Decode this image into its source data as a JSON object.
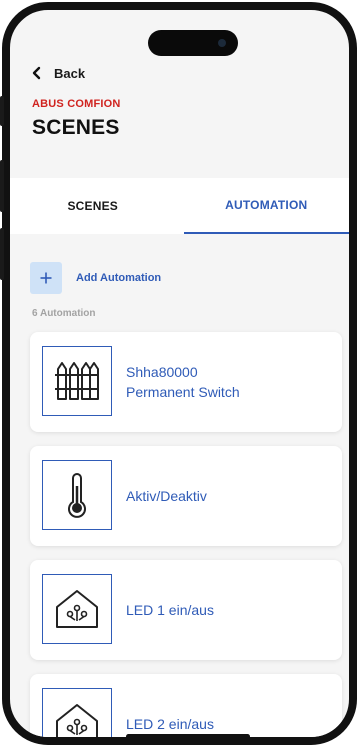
{
  "header": {
    "back_label": "Back",
    "brand": "ABUS COMFION",
    "title": "SCENES"
  },
  "tabs": [
    {
      "label": "SCENES",
      "active": false
    },
    {
      "label": "AUTOMATION",
      "active": true
    }
  ],
  "add_automation": {
    "label": "Add Automation",
    "icon": "plus-icon"
  },
  "automation_count": "6 Automation",
  "automations": [
    {
      "line1": "Shha80000",
      "line2": "Permanent Switch",
      "icon": "fence-icon"
    },
    {
      "line1": "Aktiv/Deaktiv",
      "line2": "",
      "icon": "thermometer-icon"
    },
    {
      "line1": "LED 1 ein/aus",
      "line2": "",
      "icon": "smart-home-icon"
    },
    {
      "line1": "LED 2 ein/aus",
      "line2": "",
      "icon": "smart-home-icon"
    }
  ],
  "colors": {
    "accent": "#2f5bb7",
    "brand_red": "#d0231f",
    "add_button_bg": "#cfe2f7",
    "background": "#f5f5f5"
  }
}
